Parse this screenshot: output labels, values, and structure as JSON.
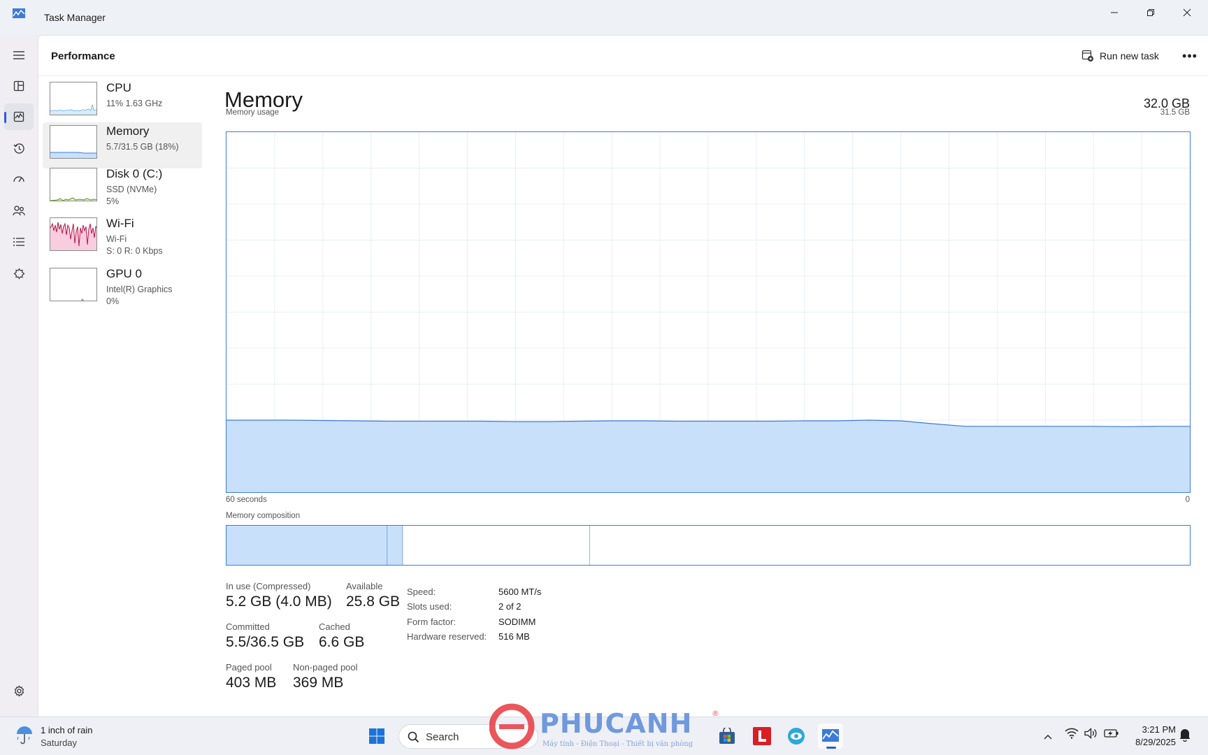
{
  "window": {
    "title": "Task Manager"
  },
  "header": {
    "title": "Performance",
    "run_task_label": "Run new task"
  },
  "nav": [
    {
      "icon": "hamburger-menu-icon"
    },
    {
      "icon": "processes-icon"
    },
    {
      "icon": "performance-icon",
      "active": true
    },
    {
      "icon": "app-history-icon"
    },
    {
      "icon": "startup-apps-icon"
    },
    {
      "icon": "users-icon"
    },
    {
      "icon": "details-icon"
    },
    {
      "icon": "services-icon"
    },
    {
      "icon": "settings-icon"
    }
  ],
  "devices": [
    {
      "name": "CPU",
      "line1": "11%  1.63 GHz",
      "line2": ""
    },
    {
      "name": "Memory",
      "line1": "5.7/31.5 GB (18%)",
      "line2": "",
      "selected": true
    },
    {
      "name": "Disk 0 (C:)",
      "line1": "SSD (NVMe)",
      "line2": "5%"
    },
    {
      "name": "Wi-Fi",
      "line1": "Wi-Fi",
      "line2": "S: 0 R: 0 Kbps"
    },
    {
      "name": "GPU 0",
      "line1": "Intel(R) Graphics",
      "line2": "0%"
    }
  ],
  "memory": {
    "title": "Memory",
    "total": "32.0 GB",
    "usage_label": "Memory usage",
    "usage_max": "31.5 GB",
    "time_left": "60 seconds",
    "time_right": "0",
    "composition_label": "Memory composition",
    "usage_history_fraction": [
      0.2,
      0.2,
      0.2,
      0.199,
      0.198,
      0.197,
      0.197,
      0.197,
      0.197,
      0.196,
      0.196,
      0.197,
      0.198,
      0.198,
      0.197,
      0.197,
      0.197,
      0.197,
      0.198,
      0.198,
      0.2,
      0.198,
      0.19,
      0.183,
      0.183,
      0.183,
      0.183,
      0.183,
      0.182,
      0.183,
      0.183
    ],
    "composition_fractions": {
      "in_use": 0.167,
      "modified": 0.016,
      "standby": 0.194,
      "free": 0.623
    },
    "stats": {
      "in_use_label": "In use (Compressed)",
      "in_use_value": "5.2 GB (4.0 MB)",
      "available_label": "Available",
      "available_value": "25.8 GB",
      "committed_label": "Committed",
      "committed_value": "5.5/36.5 GB",
      "cached_label": "Cached",
      "cached_value": "6.6 GB",
      "paged_label": "Paged pool",
      "paged_value": "403 MB",
      "nonpaged_label": "Non-paged pool",
      "nonpaged_value": "369 MB"
    },
    "specs": [
      {
        "label": "Speed:",
        "value": "5600 MT/s"
      },
      {
        "label": "Slots used:",
        "value": "2 of 2"
      },
      {
        "label": "Form factor:",
        "value": "SODIMM"
      },
      {
        "label": "Hardware reserved:",
        "value": "516 MB"
      }
    ]
  },
  "taskbar": {
    "weather": "1 inch of rain",
    "weather_day": "Saturday",
    "search_label": "Search",
    "time": "3:21 PM",
    "date": "8/29/2025"
  },
  "watermark": {
    "brand": "PHUCANH",
    "tagline": "Máy tính - Điện Thoại - Thiết bị văn phòng"
  },
  "colors": {
    "accent": "#2a5bd7",
    "memory_fill": "#c9e0fb",
    "memory_line": "#3d7bd9",
    "cpu_line": "#1f8dd6",
    "disk_line": "#4e9a06",
    "wifi_line": "#b8144b",
    "wifi_fill": "#f8cdde",
    "gpu_line": "#3d7bd9"
  }
}
